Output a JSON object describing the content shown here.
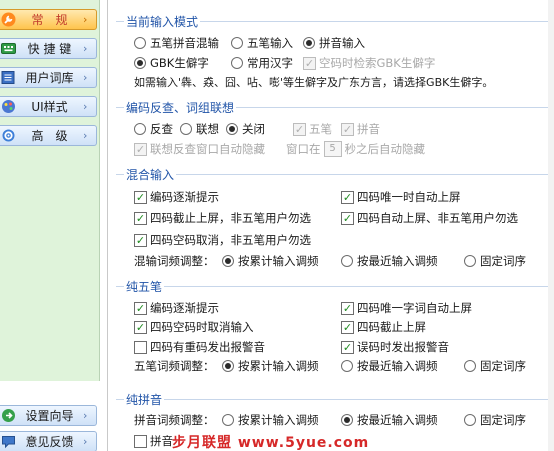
{
  "sidebar": {
    "items": [
      {
        "label": "常　规"
      },
      {
        "label": "快 捷 键"
      },
      {
        "label": "用户词库"
      },
      {
        "label": "UI样式"
      },
      {
        "label": "高　级"
      }
    ],
    "bottom_items": [
      {
        "label": "设置向导"
      },
      {
        "label": "意见反馈"
      }
    ],
    "chevron": "›"
  },
  "input_mode": {
    "title": "当前输入模式",
    "options": [
      "五笔拼音混输",
      "五笔输入",
      "拼音输入"
    ],
    "selected": "拼音输入",
    "charset_options": [
      "GBK生僻字",
      "常用汉字"
    ],
    "charset_selected": "GBK生僻字",
    "space_query_label": "空码时检索GBK生僻字",
    "note": "如需输入'犇、猋、囧、呫、嘭'等生僻字及广东方言，请选择GBK生僻字。"
  },
  "lookup": {
    "title": "编码反查、词组联想",
    "options": [
      "反查",
      "联想",
      "关闭"
    ],
    "selected": "关闭",
    "wubi_label": "五笔",
    "pinyin_label": "拼音",
    "auto_hide_label": "联想反查窗口自动隐藏",
    "window_prefix": "窗口在",
    "seconds_value": "5",
    "window_suffix": "秒之后自动隐藏"
  },
  "mixed": {
    "title": "混合输入",
    "checks": [
      {
        "label": "编码逐渐提示",
        "checked": true
      },
      {
        "label": "四码唯一时自动上屏",
        "checked": true
      },
      {
        "label": "四码截止上屏，非五笔用户勿选",
        "checked": true
      },
      {
        "label": "四码自动上屏、非五笔用户勿选",
        "checked": true
      },
      {
        "label": "四码空码取消，非五笔用户勿选",
        "checked": true
      }
    ],
    "freq_label": "混输词频调整：",
    "freq_options": [
      "按累计输入调频",
      "按最近输入调频",
      "固定词序"
    ],
    "freq_selected": "按累计输入调频"
  },
  "wubi": {
    "title": "纯五笔",
    "checks": [
      {
        "label": "编码逐渐提示",
        "checked": true
      },
      {
        "label": "四码唯一字词自动上屏",
        "checked": true
      },
      {
        "label": "四码空码时取消输入",
        "checked": true
      },
      {
        "label": "四码截止上屏",
        "checked": true
      },
      {
        "label": "四码有重码发出报警音",
        "checked": false
      },
      {
        "label": "误码时发出报警音",
        "checked": true
      }
    ],
    "freq_label": "五笔词频调整：",
    "freq_options": [
      "按累计输入调频",
      "按最近输入调频",
      "固定词序"
    ],
    "freq_selected": "按累计输入调频"
  },
  "pinyin": {
    "title": "纯拼音",
    "freq_label": "拼音词频调整：",
    "freq_options": [
      "按累计输入调频",
      "按最近输入调频",
      "固定词序"
    ],
    "freq_selected": "按最近输入调频",
    "partial_label": "拼音"
  },
  "watermark": "步月联盟 www.5yue.com",
  "colors": {
    "accent": "#2255a8",
    "sidebar_bg": "#dff3da",
    "active_tab": "#ffc44d",
    "check": "#1f8a1f",
    "watermark": "#d62828"
  }
}
